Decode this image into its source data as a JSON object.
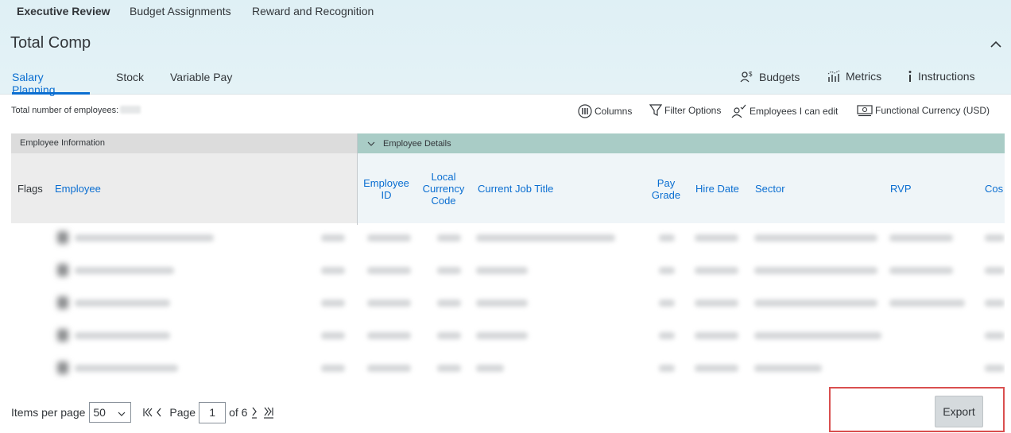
{
  "top_nav": {
    "items": [
      "Executive Review",
      "Budget Assignments",
      "Reward and Recognition"
    ]
  },
  "page": {
    "title": "Total Comp"
  },
  "sub_tabs": [
    "Salary Planning",
    "Stock",
    "Variable Pay"
  ],
  "header_actions": {
    "budgets": "Budgets",
    "metrics": "Metrics",
    "instructions": "Instructions"
  },
  "toolbar": {
    "employee_count_label": "Total number of employees:",
    "columns": "Columns",
    "filter_options": "Filter Options",
    "employees_i_can_edit": "Employees I can edit",
    "functional_currency": "Functional Currency (USD)"
  },
  "grid": {
    "group_left": "Employee Information",
    "group_right": "Employee Details",
    "columns": {
      "flags": "Flags",
      "employee": "Employee",
      "employee_id": "Employee ID",
      "local_currency_code": "Local Currency Code",
      "current_job_title": "Current Job Title",
      "pay_grade": "Pay Grade",
      "hire_date": "Hire Date",
      "sector": "Sector",
      "rvp": "RVP",
      "cost": "Cos"
    }
  },
  "pagination": {
    "items_per_page_label": "Items per page",
    "items_per_page_value": "50",
    "page_label": "Page",
    "current_page": "1",
    "of_label": "of 6"
  },
  "actions": {
    "export": "Export"
  },
  "colors": {
    "accent": "#0a6ed1",
    "group_header": "#a9ccc6",
    "highlight": "#d94f4f"
  }
}
